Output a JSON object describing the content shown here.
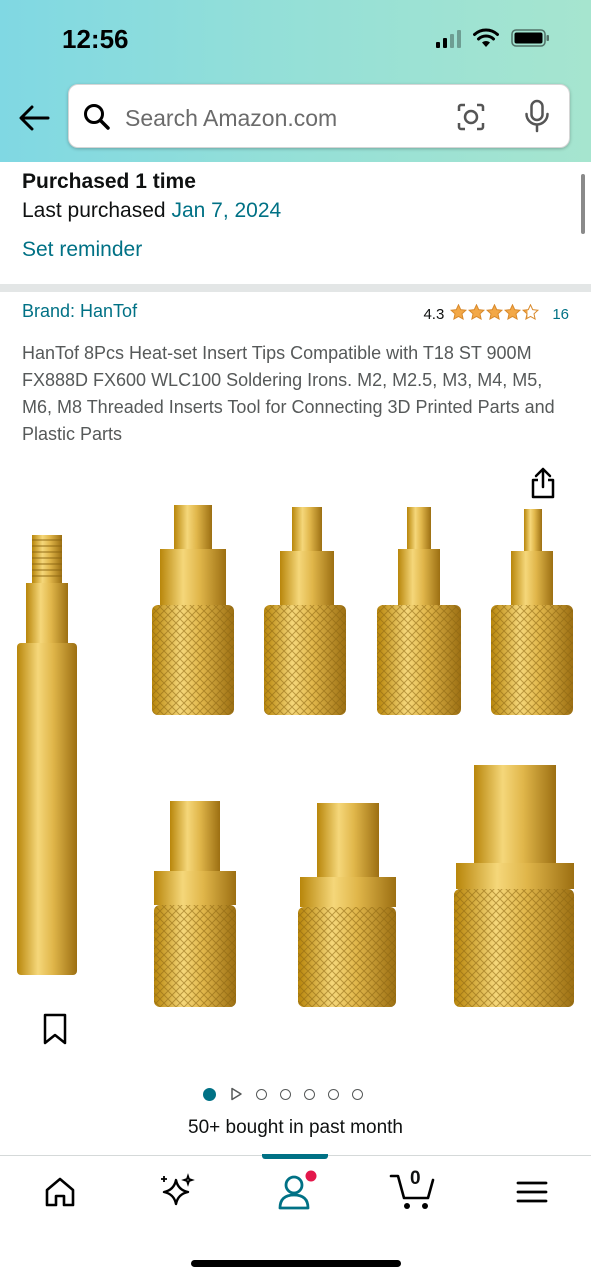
{
  "status_bar": {
    "time": "12:56"
  },
  "search": {
    "placeholder": "Search Amazon.com"
  },
  "purchase": {
    "purchased_label": "Purchased 1 time",
    "last_purchased_prefix": "Last purchased",
    "last_purchased_date": "Jan 7, 2024",
    "reminder_label": "Set reminder"
  },
  "product": {
    "brand": "Brand: HanTof",
    "rating_value": "4.3",
    "rating_stars": 4.3,
    "rating_count": "16",
    "title": "HanTof 8Pcs Heat-set Insert Tips Compatible with T18 ST 900M FX888D FX600 WLC100 Soldering Irons. M2, M2.5, M3, M4, M5, M6, M8 Threaded Inserts Tool for Connecting 3D Printed Parts and Plastic Parts",
    "bought_text": "50+ bought in past month",
    "image_count": 7,
    "active_image": 1
  },
  "tabbar": {
    "items": [
      "home-icon",
      "ai-sparkle-icon",
      "account-icon",
      "cart-icon",
      "menu-icon"
    ],
    "cart_count": "0",
    "active": "account",
    "accent": "#007185",
    "badge_color": "#e3174b"
  },
  "colors": {
    "link": "#007185",
    "star": "#f3a847"
  }
}
